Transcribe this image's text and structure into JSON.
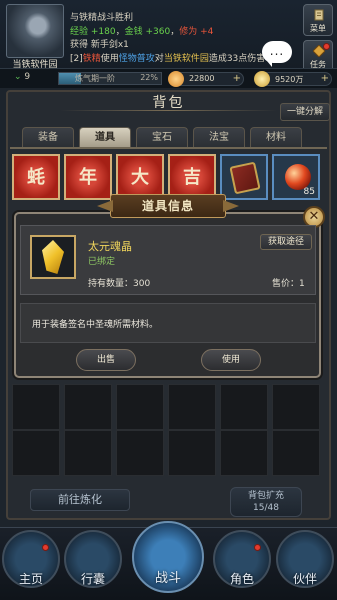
{
  "player": {
    "name": "当铁软件园",
    "level": "9",
    "cultivation_label": "炼气期一阶",
    "cultivation_percent": "22%",
    "cultivation_fraction": 0.22,
    "spirit_stones": "22800",
    "silver": "9520万"
  },
  "battle_log": [
    {
      "parts": [
        {
          "t": "与铁精战斗胜利",
          "c": ""
        }
      ]
    },
    {
      "parts": [
        {
          "t": "经验 +180",
          "c": "g"
        },
        {
          "t": "，",
          "c": ""
        },
        {
          "t": "金钱 +360",
          "c": "g"
        },
        {
          "t": "，",
          "c": ""
        },
        {
          "t": "修为 +4",
          "c": "r"
        }
      ]
    },
    {
      "parts": [
        {
          "t": "获得 新手剑x1",
          "c": ""
        }
      ]
    },
    {
      "parts": [
        {
          "t": "[2]",
          "c": ""
        },
        {
          "t": "铁精",
          "c": "r"
        },
        {
          "t": "使用",
          "c": ""
        },
        {
          "t": "怪物普攻",
          "c": "b"
        },
        {
          "t": "对",
          "c": ""
        },
        {
          "t": "当铁软件园",
          "c": "y"
        },
        {
          "t": "造成33点伤害",
          "c": ""
        }
      ]
    }
  ],
  "side_buttons": {
    "menu": "菜单",
    "task": "任务"
  },
  "chat_icon": "...",
  "bag": {
    "title": "背包",
    "quick_decompose": "一键分解",
    "tabs": [
      "装备",
      "道具",
      "宝石",
      "法宝",
      "材料"
    ],
    "active_tab": 1,
    "items": [
      {
        "icon": "talisman-icon",
        "glyph": "蚝",
        "count": ""
      },
      {
        "icon": "talisman-icon",
        "glyph": "年",
        "count": ""
      },
      {
        "icon": "talisman-icon",
        "glyph": "大",
        "count": ""
      },
      {
        "icon": "talisman-icon",
        "glyph": "吉",
        "count": ""
      },
      {
        "icon": "book-icon",
        "glyph": "",
        "count": ""
      },
      {
        "icon": "orb-icon",
        "glyph": "",
        "count": "85"
      }
    ],
    "goto_refine": "前往炼化",
    "expand_label": "背包扩充",
    "capacity": "15/48"
  },
  "item_dialog": {
    "title": "道具信息",
    "close": "✕",
    "name": "太元魂晶",
    "bound": "已绑定",
    "owned": "持有数量：300",
    "price": "售价：1",
    "get_way": "获取途径",
    "description": "用于装备签名中圣魂所需材料。",
    "sell": "出售",
    "use": "使用"
  },
  "nav": [
    {
      "label": "主页",
      "badge": true
    },
    {
      "label": "行囊",
      "badge": false
    },
    {
      "label": "战斗",
      "badge": false
    },
    {
      "label": "角色",
      "badge": true
    },
    {
      "label": "伙伴",
      "badge": false
    }
  ],
  "colors": {
    "accent_gold": "#c8a764",
    "item_name": "#f0d55c",
    "bound_green": "#8ec763",
    "badge_red": "#e23b2e"
  }
}
